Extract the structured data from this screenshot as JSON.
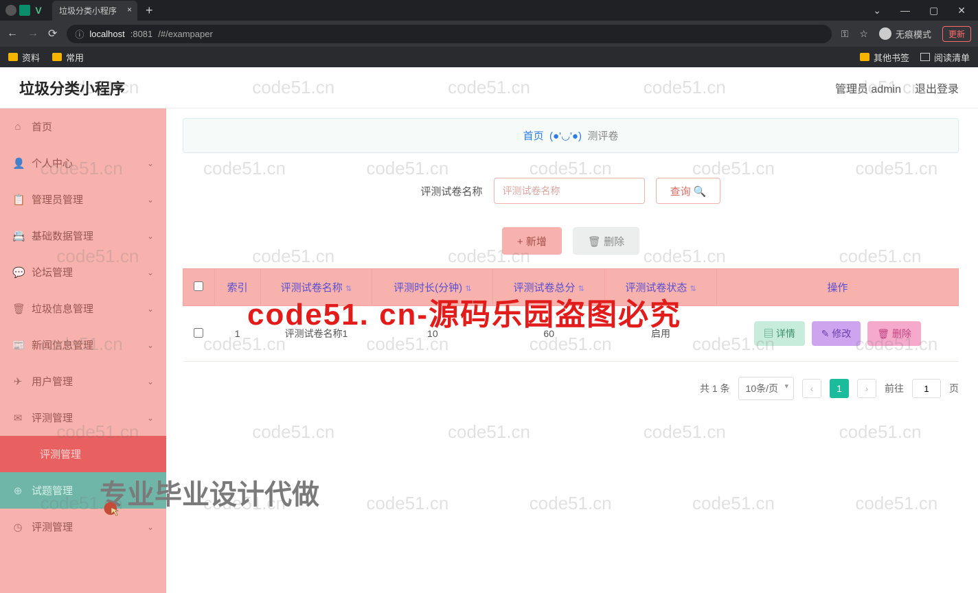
{
  "browser": {
    "tab_title": "垃圾分类小程序",
    "url_host": "localhost",
    "url_port": ":8081",
    "url_path": "/#/exampaper",
    "incognito": "无痕模式",
    "update": "更新",
    "bookmarks": {
      "folder1": "资料",
      "folder2": "常用",
      "other": "其他书签",
      "reading": "阅读清单"
    },
    "win": {
      "min": "—",
      "max": "▢",
      "close": "✕"
    }
  },
  "header": {
    "title": "垃圾分类小程序",
    "admin": "管理员 admin",
    "logout": "退出登录"
  },
  "sidebar": {
    "items": [
      {
        "icon": "⌂",
        "label": "首页"
      },
      {
        "icon": "👤",
        "label": "个人中心"
      },
      {
        "icon": "📋",
        "label": "管理员管理"
      },
      {
        "icon": "📇",
        "label": "基础数据管理"
      },
      {
        "icon": "💬",
        "label": "论坛管理"
      },
      {
        "icon": "🗑",
        "label": "垃圾信息管理"
      },
      {
        "icon": "📰",
        "label": "新闻信息管理"
      },
      {
        "icon": "✈",
        "label": "用户管理"
      },
      {
        "icon": "✉",
        "label": "评测管理"
      }
    ],
    "sub_active": "评测管理",
    "sub_items": [
      {
        "icon": "⊕",
        "label": "试题管理"
      },
      {
        "icon": "◷",
        "label": "评测管理"
      }
    ]
  },
  "crumb": {
    "home": "首页",
    "face": "(●'◡'●)",
    "current": "测评卷"
  },
  "search": {
    "label": "评测试卷名称",
    "placeholder": "评测试卷名称",
    "btn": "查询"
  },
  "actions": {
    "add": "+ 新增",
    "del": "删除"
  },
  "table": {
    "headers": {
      "idx": "索引",
      "name": "评测试卷名称",
      "dur": "评测时长(分钟)",
      "score": "评测试卷总分",
      "status": "评测试卷状态",
      "op": "操作"
    },
    "rows": [
      {
        "idx": "1",
        "name": "评测试卷名称1",
        "dur": "10",
        "score": "60",
        "status": "启用"
      }
    ],
    "row_btns": {
      "detail": "详情",
      "edit": "修改",
      "del": "删除"
    }
  },
  "pager": {
    "total": "共 1 条",
    "size": "10条/页",
    "cur": "1",
    "goto": "前往",
    "page_unit": "页",
    "goto_val": "1"
  },
  "watermark": {
    "text": "code51.cn",
    "red": "code51. cn-源码乐园盗图必究",
    "grey": "专业毕业设计代做"
  }
}
